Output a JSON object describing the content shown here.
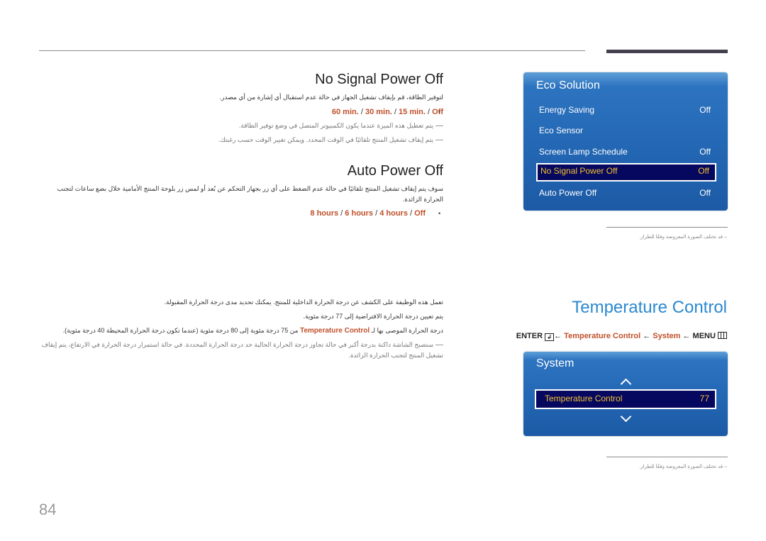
{
  "page_number": "84",
  "no_signal_section": {
    "title": "No Signal Power Off",
    "description": "لتوفير الطاقة، قم بإيقاف تشغيل الجهاز في حالة عدم استقبال أي إشارة من أي مصدر.",
    "options": [
      "60 min.",
      "30 min.",
      "15 min.",
      "Off"
    ],
    "separator": " / ",
    "notes": [
      "يتم تعطيل هذه الميزة عندما يكون الكمبيوتر المتصل في وضع توفير الطاقة.",
      "يتم إيقاف تشغيل المنتج تلقائيًا في الوقت المحدد. ويمكن تغيير الوقت حسب رغبتك."
    ]
  },
  "auto_power_section": {
    "title": "Auto Power Off",
    "description": "سوف يتم إيقاف تشغيل المنتج تلقائيًا في حالة عدم الضغط على أي زر بجهاز التحكم عن بُعد أو لمس زر بلوحة المنتج الأمامية خلال بضع ساعات لتجنب الحرارة الزائدة.",
    "options": [
      "8 hours",
      "6 hours",
      "4 hours",
      "Off"
    ],
    "separator": " / "
  },
  "eco_menu": {
    "title": "Eco Solution",
    "items": [
      {
        "label": "Energy Saving",
        "value": "Off"
      },
      {
        "label": "Eco Sensor",
        "value": ""
      },
      {
        "label": "Screen Lamp Schedule",
        "value": "Off"
      },
      {
        "label": "No Signal Power Off",
        "value": "Off",
        "selected": true
      },
      {
        "label": "Auto Power Off",
        "value": "Off"
      }
    ],
    "note": "قد تختلف الصورة المعروضة وفقًا للطراز."
  },
  "temperature_section": {
    "title": "Temperature Control",
    "path": {
      "enter": "ENTER",
      "item": "Temperature Control",
      "system": "System",
      "menu": "MENU",
      "arrow": "←"
    },
    "lines": [
      "تعمل هذه الوظيفة على الكشف عن درجة الحرارة الداخلية للمنتج. يمكنك تحديد مدى درجة الحرارة المقبولة.",
      "يتم تعيين درجة الحرارة الافتراضية إلى 77 درجة مئوية."
    ],
    "line3_pre": "درجة الحرارة الموصى بها لـ ",
    "line3_hl": "Temperature Control",
    "line3_post": " من 75 درجة مئوية إلى 80 درجة مئوية (عندما تكون درجة الحرارة المحيطة 40 درجة مئوية).",
    "note": "ستصبح الشاشة داكنة بدرجة أكبر في حالة تجاوز درجة الحرارة الحالية حد درجة الحرارة المحددة. في حالة استمرار درجة الحرارة في الارتفاع، يتم إيقاف تشغيل المنتج لتجنب الحرارة الزائدة."
  },
  "system_menu": {
    "title": "System",
    "item": {
      "label": "Temperature Control",
      "value": "77"
    },
    "note": "قد تختلف الصورة المعروضة وفقًا للطراز."
  },
  "colors": {
    "accent_orange": "#c0502a",
    "title_blue": "#2b89d0",
    "menu_blue": "#2468b5",
    "selected_bg": "#06075e",
    "selected_text": "#f1c232"
  }
}
